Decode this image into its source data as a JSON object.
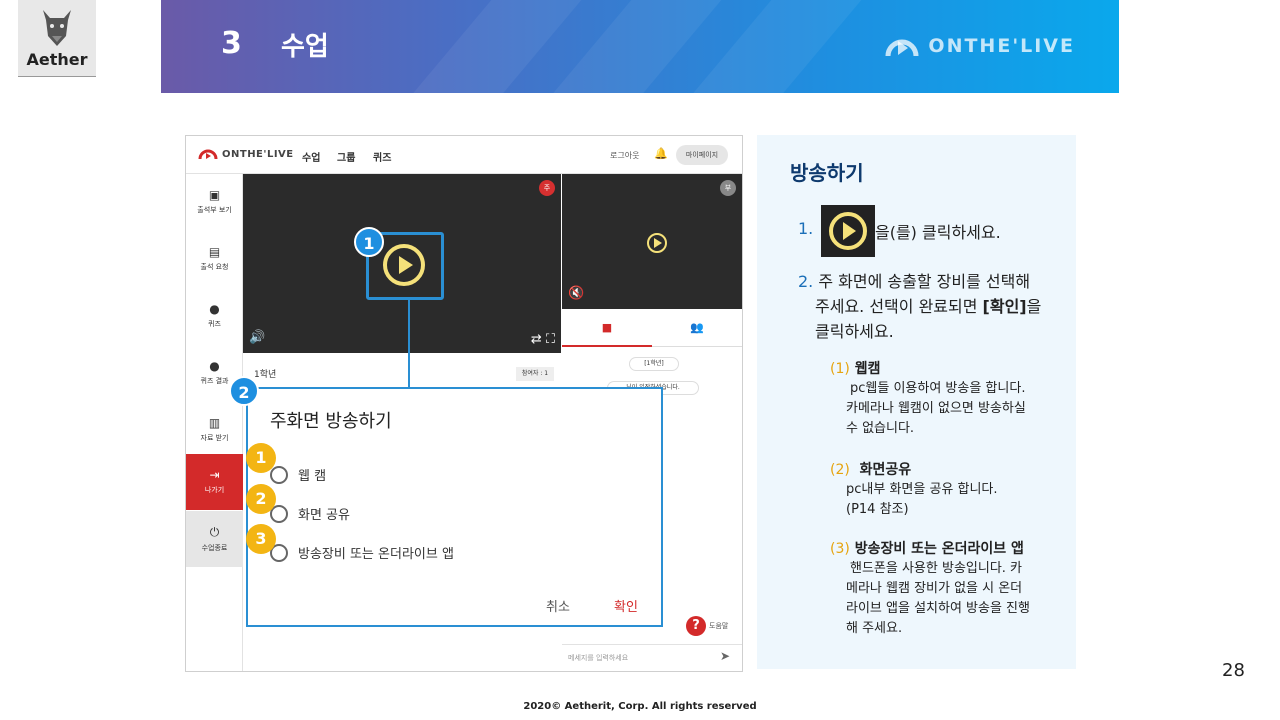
{
  "logo": {
    "text": "Aether",
    "icon": "bull-head-icon"
  },
  "banner": {
    "number": "3",
    "title": "수업",
    "brand": "ONTHE'LIVE"
  },
  "app": {
    "nav": {
      "brand": "ONTHE'LIVE",
      "items": [
        "수업",
        "그룹",
        "퀴즈"
      ],
      "logout": "로그아웃",
      "mypage": "마이페이지"
    },
    "sidebar": [
      {
        "label": "출석부 보기",
        "icon": "attendance-icon"
      },
      {
        "label": "출석 요청",
        "icon": "request-icon"
      },
      {
        "label": "퀴즈",
        "icon": "quiz-icon"
      },
      {
        "label": "퀴즈 결과",
        "icon": "quiz-result-icon"
      },
      {
        "label": "자료 받기",
        "icon": "download-icon"
      },
      {
        "label": "나가기",
        "icon": "exit-icon"
      },
      {
        "label": "수업종료",
        "icon": "power-icon"
      }
    ],
    "video_main_badge": "주",
    "video_sub_badge": "부",
    "grade": "1학년",
    "participants": "참여자 : 1",
    "chat_chip": "[1학년]",
    "chat_line": "님이 입장하셨습니다.",
    "help": "도움말",
    "message_placeholder": "메세지를 입력하세요"
  },
  "dialog": {
    "title": "주화면 방송하기",
    "options": [
      "웹 캠",
      "화면 공유",
      "방송장비 또는 온더라이브 앱"
    ],
    "cancel": "취소",
    "confirm": "확인"
  },
  "callouts": {
    "play": "1",
    "dialog": "2",
    "options": [
      "1",
      "2",
      "3"
    ]
  },
  "panel": {
    "title": "방송하기",
    "step1_num": "1.",
    "step1_text": "을(를) 클릭하세요.",
    "step2_num": "2.",
    "step2_text_a": "주 화면에 송출할 장비를 선택해",
    "step2_text_b": "주세요. 선택이 완료되면 ",
    "step2_bold": "[확인]",
    "step2_text_c": "을",
    "step2_text_d": "클릭하세요.",
    "subs": [
      {
        "num": "(1)",
        "head": "웹캠",
        "lines": [
          "pc웹들 이용하여 방송을 합니다.",
          "카메라나 웹캠이 없으면 방송하실",
          "수 없습니다."
        ]
      },
      {
        "num": "(2)",
        "head": "화면공유",
        "lines": [
          "pc내부 화면을 공유 합니다.",
          "(P14 참조)"
        ]
      },
      {
        "num": "(3)",
        "head": "방송장비 또는 온더라이브 앱",
        "lines": [
          "핸드폰을 사용한 방송입니다. 카",
          "메라나 웹캠 장비가 없을 시 온더",
          "라이브 앱을 설치하여 방송을 진행",
          "해 주세요."
        ]
      }
    ]
  },
  "page_number": "28",
  "copyright": "2020© Aetherit, Corp. All rights reserved"
}
